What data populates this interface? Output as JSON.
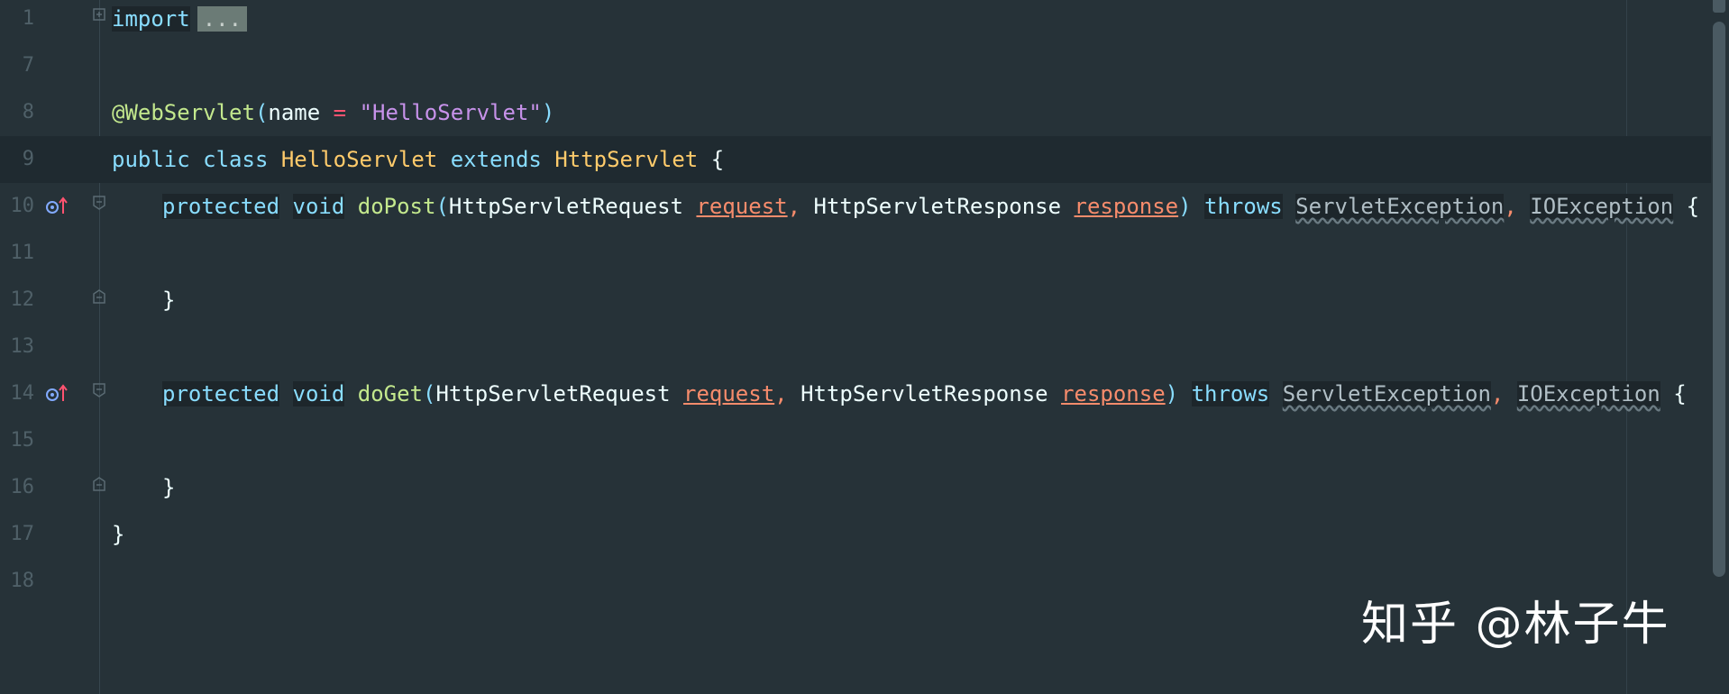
{
  "editor": {
    "lines": [
      {
        "num": "1",
        "import_kw": "import",
        "folded": "..."
      },
      {
        "num": "7"
      },
      {
        "num": "8",
        "annotation": "@WebServlet",
        "lparen": "(",
        "attr": "name",
        "eq": "=",
        "value": "\"HelloServlet\"",
        "rparen": ")"
      },
      {
        "num": "9",
        "public": "public",
        "class": "class",
        "name": "HelloServlet",
        "extends": "extends",
        "super": "HttpServlet",
        "brace": "{"
      },
      {
        "num": "10",
        "protected": "protected",
        "void": "void",
        "method": "doPost",
        "lparen": "(",
        "t1": "HttpServletRequest",
        "p1": "request",
        "c1": ",",
        "t2": "HttpServletResponse",
        "p2": "response",
        "rparen": ")",
        "throws": "throws",
        "e1": "ServletException",
        "c2": ",",
        "e2": "IOException",
        "brace": "{"
      },
      {
        "num": "11"
      },
      {
        "num": "12",
        "brace": "}"
      },
      {
        "num": "13"
      },
      {
        "num": "14",
        "protected": "protected",
        "void": "void",
        "method": "doGet",
        "lparen": "(",
        "t1": "HttpServletRequest",
        "p1": "request",
        "c1": ",",
        "t2": "HttpServletResponse",
        "p2": "response",
        "rparen": ")",
        "throws": "throws",
        "e1": "ServletException",
        "c2": ",",
        "e2": "IOException",
        "brace": "{"
      },
      {
        "num": "15"
      },
      {
        "num": "16",
        "brace": "}"
      },
      {
        "num": "17",
        "brace": "}"
      },
      {
        "num": "18"
      }
    ]
  },
  "watermark": {
    "text": "知乎 @林子牛"
  },
  "colors": {
    "background": "#263238",
    "keyword": "#89ddff",
    "class": "#ffcb6b",
    "string": "#c792ea",
    "function": "#c3e88d",
    "parameter": "#f78c6c"
  },
  "icons": {
    "override": "override-method-icon",
    "fold": "fold-marker-icon"
  }
}
